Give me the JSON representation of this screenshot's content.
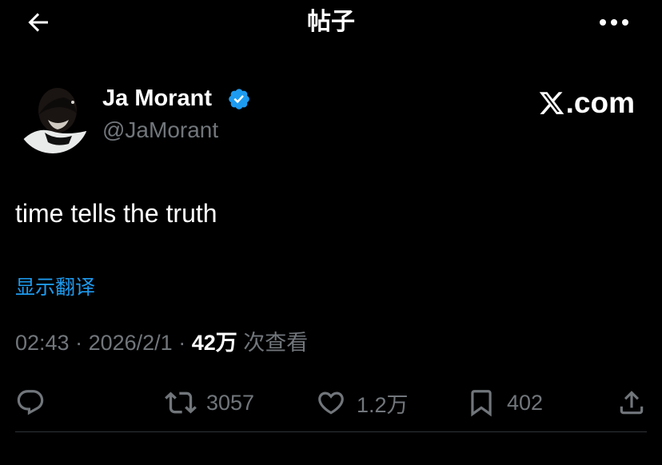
{
  "header": {
    "title": "帖子",
    "back_icon": "arrow-left-icon",
    "more_icon": "more-horizontal-icon"
  },
  "author": {
    "name": "Ja Morant",
    "handle": "@JaMorant",
    "verified": true,
    "verified_color": "#1d9bf0"
  },
  "watermark": {
    "text": ".com",
    "logo": "x-logo-icon"
  },
  "tweet": {
    "text": "time tells the truth",
    "translate_label": "显示翻译"
  },
  "meta": {
    "time": "02:43",
    "separator": " · ",
    "date": "2026/2/1",
    "separator2": " · ",
    "views_count": "42万",
    "views_label": " 次查看"
  },
  "actions": {
    "reply": {
      "icon": "reply-icon",
      "count": ""
    },
    "repost": {
      "icon": "repost-icon",
      "count": "3057"
    },
    "like": {
      "icon": "heart-icon",
      "count": "1.2万"
    },
    "bookmark": {
      "icon": "bookmark-icon",
      "count": "402"
    },
    "share": {
      "icon": "share-icon",
      "count": ""
    }
  },
  "colors": {
    "background": "#000000",
    "primary_text": "#ffffff",
    "secondary_text": "#71767b",
    "link": "#1d9bf0",
    "divider": "#2f3336"
  }
}
